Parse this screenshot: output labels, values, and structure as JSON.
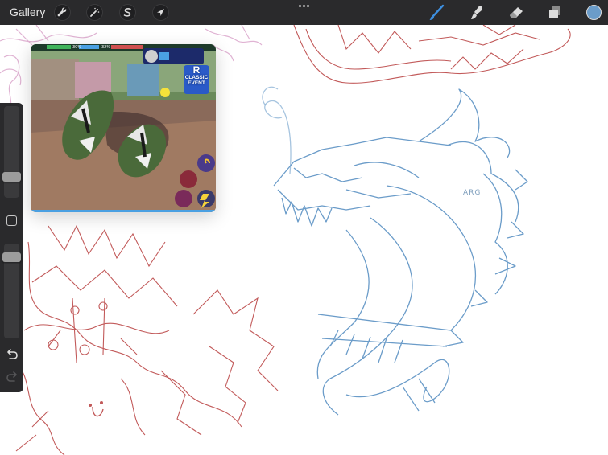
{
  "toolbar": {
    "gallery_label": "Gallery",
    "tools_left": [
      {
        "name": "actions",
        "icon": "wrench-icon"
      },
      {
        "name": "adjustments",
        "icon": "magic-wand-icon"
      },
      {
        "name": "selection",
        "icon": "selection-s-icon"
      },
      {
        "name": "transform",
        "icon": "arrow-cursor-icon"
      }
    ],
    "more_icon": "more-dots-icon",
    "tools_right": [
      {
        "name": "brush",
        "icon": "brush-icon",
        "active": true
      },
      {
        "name": "smudge",
        "icon": "smudge-icon",
        "active": false
      },
      {
        "name": "eraser",
        "icon": "eraser-icon",
        "active": false
      },
      {
        "name": "layers",
        "icon": "layers-icon",
        "active": false
      }
    ],
    "current_color": "#6b9cc9"
  },
  "sidebar": {
    "brush_size": 0.2,
    "brush_opacity": 0.9,
    "modify_icon": "square-icon",
    "undo_icon": "undo-icon",
    "redo_icon": "redo-icon",
    "redo_enabled": false
  },
  "canvas": {
    "background": "#ffffff",
    "sketch_colors": {
      "red": "#c25a5a",
      "blue": "#6b9cc9",
      "pink": "#d9a3c9"
    },
    "signature_text": "ARG"
  },
  "reference": {
    "event_badge": [
      "R",
      "CLASSIC",
      "EVENT"
    ],
    "stat_values": [
      "30%",
      "32%"
    ]
  }
}
